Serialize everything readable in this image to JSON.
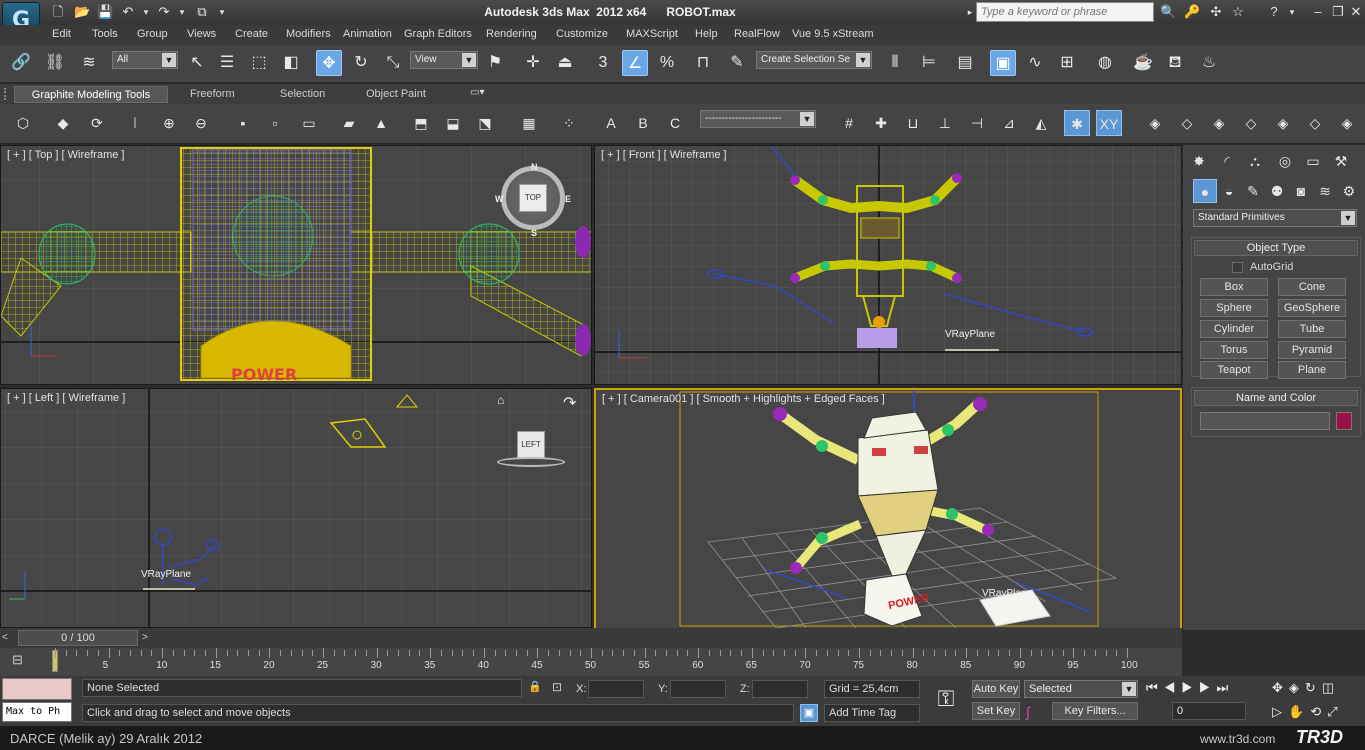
{
  "app": {
    "title": "Autodesk 3ds Max  2012 x64",
    "file": "ROBOT.max",
    "logo": "3ds-max-logo-icon"
  },
  "search": {
    "placeholder": "Type a keyword or phrase"
  },
  "menubar": {
    "items": [
      "Edit",
      "Tools",
      "Group",
      "Views",
      "Create",
      "Modifiers",
      "Animation",
      "Graph Editors",
      "Rendering",
      "Customize",
      "MAXScript",
      "Help",
      "RealFlow",
      "Vue 9.5 xStream"
    ]
  },
  "toolbar": {
    "selection_filter": "All",
    "ref_coord": "View",
    "named_selection": "Create Selection Se",
    "snap_label": "3",
    "angle_snap_label": "%"
  },
  "ribbon": {
    "tabs": [
      "Graphite Modeling Tools",
      "Freeform",
      "Selection",
      "Object Paint"
    ],
    "labels": {
      "a": "A",
      "b": "B",
      "c": "C",
      "xy": "XY"
    },
    "dropdown": "-----------------------"
  },
  "viewports": {
    "top": {
      "label": "[ + ] [ Top ] [ Wireframe ]",
      "cube": "TOP",
      "n": "N",
      "s": "S",
      "w": "W",
      "e": "E",
      "text": "POWER"
    },
    "front": {
      "label": "[ + ] [ Front ] [ Wireframe ]",
      "vray": "VRayPlane"
    },
    "left": {
      "label": "[ + ] [ Left ] [ Wireframe ]",
      "cube": "LEFT",
      "vray": "VRayPlane"
    },
    "camera": {
      "label": "[ + ] [ Camera001 ] [ Smooth + Highlights + Edged Faces ]",
      "vray": "VRayPlane",
      "logo": "POWER"
    }
  },
  "command_panel": {
    "dropdown": "Standard Primitives",
    "object_type": "Object Type",
    "autogrid": "AutoGrid",
    "buttons": [
      "Box",
      "Cone",
      "Sphere",
      "GeoSphere",
      "Cylinder",
      "Tube",
      "Torus",
      "Pyramid",
      "Teapot",
      "Plane"
    ],
    "name_color": "Name and Color",
    "object_color": "#9c1048"
  },
  "timeline": {
    "counter": "0 / 100",
    "ticks": [
      "5",
      "10",
      "15",
      "20",
      "25",
      "30",
      "35",
      "40",
      "45",
      "50",
      "55",
      "60",
      "65",
      "70",
      "75",
      "80",
      "85",
      "90",
      "95",
      "100"
    ]
  },
  "status": {
    "maxscript_input": "Max to Ph",
    "selected": "None Selected",
    "prompt": "Click and drag to select and move objects",
    "x_label": "X:",
    "y_label": "Y:",
    "z_label": "Z:",
    "grid": "Grid = 25,4cm",
    "add_time_tag": "Add Time Tag",
    "auto_key": "Auto Key",
    "set_key": "Set Key",
    "selected_dd": "Selected",
    "key_filters": "Key Filters...",
    "frame": "0"
  },
  "footer": {
    "left": "DARCE (Melik ay)  29 Aralık 2012",
    "right": "www.tr3d.com",
    "brand": "TR3D"
  }
}
